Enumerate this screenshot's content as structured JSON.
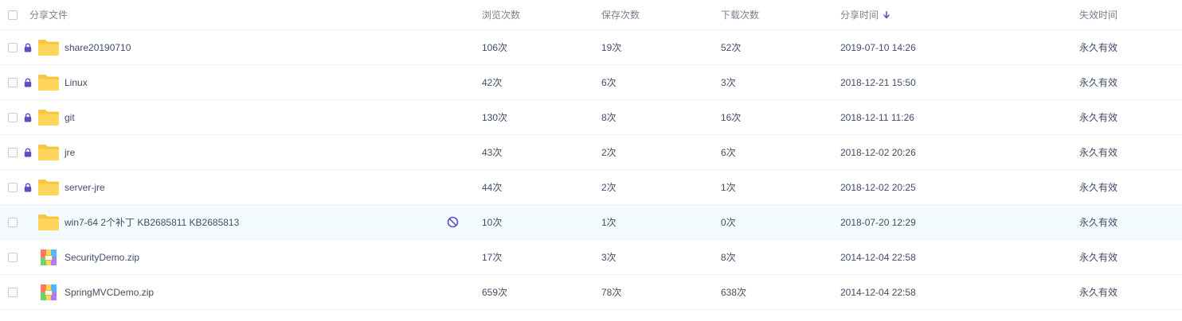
{
  "header": {
    "name": "分享文件",
    "views": "浏览次数",
    "saves": "保存次数",
    "downloads": "下载次数",
    "share_time": "分享时间",
    "expire": "失效时间"
  },
  "colors": {
    "accent": "#5e4fc5",
    "folder": "#ffd65c",
    "row_hover": "#f4fbff"
  },
  "rows": [
    {
      "name": "share20190710",
      "type": "folder",
      "locked": true,
      "blocked": false,
      "views": "106次",
      "saves": "19次",
      "downloads": "52次",
      "time": "2019-07-10 14:26",
      "expire": "永久有效"
    },
    {
      "name": "Linux",
      "type": "folder",
      "locked": true,
      "blocked": false,
      "views": "42次",
      "saves": "6次",
      "downloads": "3次",
      "time": "2018-12-21 15:50",
      "expire": "永久有效"
    },
    {
      "name": "git",
      "type": "folder",
      "locked": true,
      "blocked": false,
      "views": "130次",
      "saves": "8次",
      "downloads": "16次",
      "time": "2018-12-11 11:26",
      "expire": "永久有效"
    },
    {
      "name": "jre",
      "type": "folder",
      "locked": true,
      "blocked": false,
      "views": "43次",
      "saves": "2次",
      "downloads": "6次",
      "time": "2018-12-02 20:26",
      "expire": "永久有效"
    },
    {
      "name": "server-jre",
      "type": "folder",
      "locked": true,
      "blocked": false,
      "views": "44次",
      "saves": "2次",
      "downloads": "1次",
      "time": "2018-12-02 20:25",
      "expire": "永久有效"
    },
    {
      "name": "win7-64 2个补丁 KB2685811 KB2685813",
      "type": "folder",
      "locked": false,
      "blocked": true,
      "views": "10次",
      "saves": "1次",
      "downloads": "0次",
      "time": "2018-07-20 12:29",
      "expire": "永久有效"
    },
    {
      "name": "SecurityDemo.zip",
      "type": "zip",
      "locked": false,
      "blocked": false,
      "views": "17次",
      "saves": "3次",
      "downloads": "8次",
      "time": "2014-12-04 22:58",
      "expire": "永久有效"
    },
    {
      "name": "SpringMVCDemo.zip",
      "type": "zip",
      "locked": false,
      "blocked": false,
      "views": "659次",
      "saves": "78次",
      "downloads": "638次",
      "time": "2014-12-04 22:58",
      "expire": "永久有效"
    }
  ]
}
